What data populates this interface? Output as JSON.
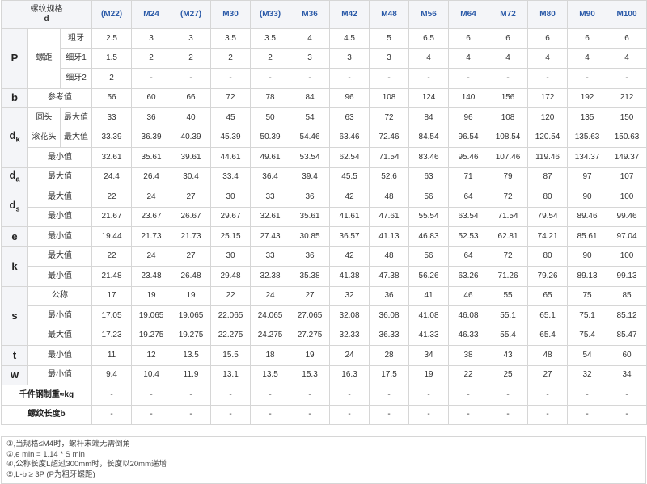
{
  "header": {
    "corner_line1": "螺纹规格",
    "corner_line2": "d",
    "sizes": [
      "(M22)",
      "M24",
      "(M27)",
      "M30",
      "(M33)",
      "M36",
      "M42",
      "M48",
      "M56",
      "M64",
      "M72",
      "M80",
      "M90",
      "M100"
    ]
  },
  "labels": {
    "P": "P",
    "b": "b",
    "dk": "d",
    "dk_sub": "k",
    "da": "d",
    "da_sub": "a",
    "ds": "d",
    "ds_sub": "s",
    "e": "e",
    "k": "k",
    "s": "s",
    "t": "t",
    "w": "w",
    "pitch": "螺距",
    "coarse": "粗牙",
    "fine1": "细牙1",
    "fine2": "细牙2",
    "ref": "参考值",
    "round_head": "圆头",
    "knurled_head": "滚花头",
    "max": "最大值",
    "min": "最小值",
    "nominal": "公称",
    "weight": "千件钢制重≈kg",
    "thread_len": "螺纹长度b"
  },
  "rows": {
    "P_coarse": [
      "2.5",
      "3",
      "3",
      "3.5",
      "3.5",
      "4",
      "4.5",
      "5",
      "6.5",
      "6",
      "6",
      "6",
      "6",
      "6"
    ],
    "P_fine1": [
      "1.5",
      "2",
      "2",
      "2",
      "2",
      "3",
      "3",
      "3",
      "4",
      "4",
      "4",
      "4",
      "4",
      "4"
    ],
    "P_fine2": [
      "2",
      "-",
      "-",
      "-",
      "-",
      "-",
      "-",
      "-",
      "-",
      "-",
      "-",
      "-",
      "-",
      "-"
    ],
    "b_ref": [
      "56",
      "60",
      "66",
      "72",
      "78",
      "84",
      "96",
      "108",
      "124",
      "140",
      "156",
      "172",
      "192",
      "212"
    ],
    "dk_round_max": [
      "33",
      "36",
      "40",
      "45",
      "50",
      "54",
      "63",
      "72",
      "84",
      "96",
      "108",
      "120",
      "135",
      "150"
    ],
    "dk_knurl_max": [
      "33.39",
      "36.39",
      "40.39",
      "45.39",
      "50.39",
      "54.46",
      "63.46",
      "72.46",
      "84.54",
      "96.54",
      "108.54",
      "120.54",
      "135.63",
      "150.63"
    ],
    "dk_min": [
      "32.61",
      "35.61",
      "39.61",
      "44.61",
      "49.61",
      "53.54",
      "62.54",
      "71.54",
      "83.46",
      "95.46",
      "107.46",
      "119.46",
      "134.37",
      "149.37"
    ],
    "da_max": [
      "24.4",
      "26.4",
      "30.4",
      "33.4",
      "36.4",
      "39.4",
      "45.5",
      "52.6",
      "63",
      "71",
      "79",
      "87",
      "97",
      "107"
    ],
    "ds_max": [
      "22",
      "24",
      "27",
      "30",
      "33",
      "36",
      "42",
      "48",
      "56",
      "64",
      "72",
      "80",
      "90",
      "100"
    ],
    "ds_min": [
      "21.67",
      "23.67",
      "26.67",
      "29.67",
      "32.61",
      "35.61",
      "41.61",
      "47.61",
      "55.54",
      "63.54",
      "71.54",
      "79.54",
      "89.46",
      "99.46"
    ],
    "e_min": [
      "19.44",
      "21.73",
      "21.73",
      "25.15",
      "27.43",
      "30.85",
      "36.57",
      "41.13",
      "46.83",
      "52.53",
      "62.81",
      "74.21",
      "85.61",
      "97.04"
    ],
    "k_max": [
      "22",
      "24",
      "27",
      "30",
      "33",
      "36",
      "42",
      "48",
      "56",
      "64",
      "72",
      "80",
      "90",
      "100"
    ],
    "k_min": [
      "21.48",
      "23.48",
      "26.48",
      "29.48",
      "32.38",
      "35.38",
      "41.38",
      "47.38",
      "56.26",
      "63.26",
      "71.26",
      "79.26",
      "89.13",
      "99.13"
    ],
    "s_nominal": [
      "17",
      "19",
      "19",
      "22",
      "24",
      "27",
      "32",
      "36",
      "41",
      "46",
      "55",
      "65",
      "75",
      "85"
    ],
    "s_min": [
      "17.05",
      "19.065",
      "19.065",
      "22.065",
      "24.065",
      "27.065",
      "32.08",
      "36.08",
      "41.08",
      "46.08",
      "55.1",
      "65.1",
      "75.1",
      "85.12"
    ],
    "s_max": [
      "17.23",
      "19.275",
      "19.275",
      "22.275",
      "24.275",
      "27.275",
      "32.33",
      "36.33",
      "41.33",
      "46.33",
      "55.4",
      "65.4",
      "75.4",
      "85.47"
    ],
    "t_min": [
      "11",
      "12",
      "13.5",
      "15.5",
      "18",
      "19",
      "24",
      "28",
      "34",
      "38",
      "43",
      "48",
      "54",
      "60"
    ],
    "w_min": [
      "9.4",
      "10.4",
      "11.9",
      "13.1",
      "13.5",
      "15.3",
      "16.3",
      "17.5",
      "19",
      "22",
      "25",
      "27",
      "32",
      "34"
    ],
    "weight": [
      "-",
      "-",
      "-",
      "-",
      "-",
      "-",
      "-",
      "-",
      "-",
      "-",
      "-",
      "-",
      "-",
      "-"
    ],
    "thread_len": [
      "-",
      "-",
      "-",
      "-",
      "-",
      "-",
      "-",
      "-",
      "-",
      "-",
      "-",
      "-",
      "-",
      "-"
    ]
  },
  "notes": [
    "①,当规格≤M4时，螺杆末端无需倒角",
    "②,e min = 1.14 * S min",
    "④,公称长度L超过300mm时，长度以20mm递增",
    "⑤,L-b ≥ 3P (P为粗牙螺距)"
  ]
}
